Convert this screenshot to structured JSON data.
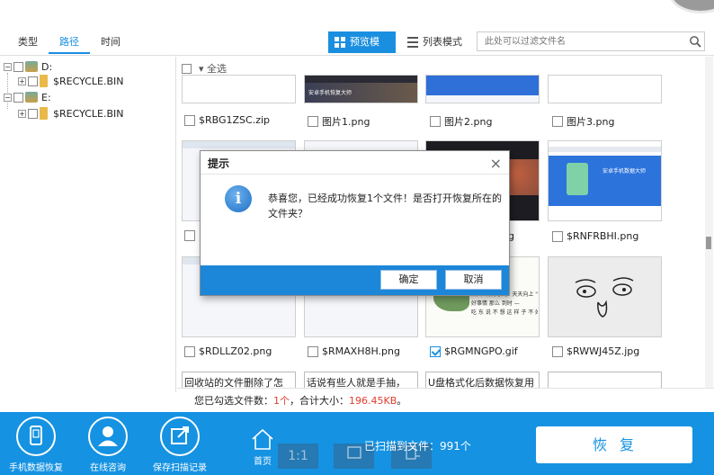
{
  "tabs": [
    {
      "label": "类型"
    },
    {
      "label": "路径"
    },
    {
      "label": "时间"
    }
  ],
  "view_modes": {
    "preview_label": "预览模式",
    "list_label": "列表模式"
  },
  "filter": {
    "placeholder": "此处可以过滤文件名"
  },
  "tree": {
    "drive_d": "D:",
    "drive_d_child": "$RECYCLE.BIN",
    "drive_e": "E:",
    "drive_e_child": "$RECYCLE.BIN"
  },
  "select_all_label": "全选",
  "files": [
    {
      "name": "$RBG1ZSC.zip",
      "checked": false
    },
    {
      "name": "图片1.png",
      "checked": false
    },
    {
      "name": "图片2.png",
      "checked": false
    },
    {
      "name": "图片3.png",
      "checked": false
    },
    {
      "name": "g",
      "checked": false
    },
    {
      "name": "$RNFRBHI.png",
      "checked": false
    },
    {
      "name": "$RDLLZ02.png",
      "checked": false
    },
    {
      "name": "$RMAXH8H.png",
      "checked": false
    },
    {
      "name": "$RGMNGPO.gif",
      "checked": true
    },
    {
      "name": "$RWWJ45Z.jpg",
      "checked": false
    }
  ],
  "thumb_texts": {
    "dark_banner": "安卓手机恢复大师",
    "blue_banner": "安卓手机数据大师",
    "gif_text1": "后面 \"好好学习\" 天天向上 \"天天向",
    "gif_text2": "好事情 那么 到时 —",
    "gif_text3": "吃 东 说 不 想 这 样 子 不 好"
  },
  "text_cards": [
    "回收站的文件删除了怎",
    "话说有些人就是手抽，",
    "U盘格式化后数据恢复用"
  ],
  "status": {
    "prefix": "您已勾选文件数：",
    "count": "1个",
    "middle": "，合计大小：",
    "size": "196.45KB",
    "suffix": "。"
  },
  "dialog": {
    "title": "提示",
    "close": "×",
    "icon_letter": "i",
    "message": "恭喜您，已经成功恢复1个文件！是否打开恢复所在的文件夹？",
    "ok_label": "确定",
    "cancel_label": "取消"
  },
  "bottom": {
    "tool1_label": "手机数据恢复",
    "tool2_label": "在线咨询",
    "tool3_label": "保存扫描记录",
    "home_label": "首页",
    "scanned_text": "已扫描到文件：991个",
    "ghost1": "1:1",
    "recover_label": "恢复"
  },
  "colors": {
    "accent": "#1a8fe0",
    "bottom_bar": "#1592e2",
    "dialog_footer": "#1c86d8",
    "highlight_red": "#e23c2c"
  }
}
